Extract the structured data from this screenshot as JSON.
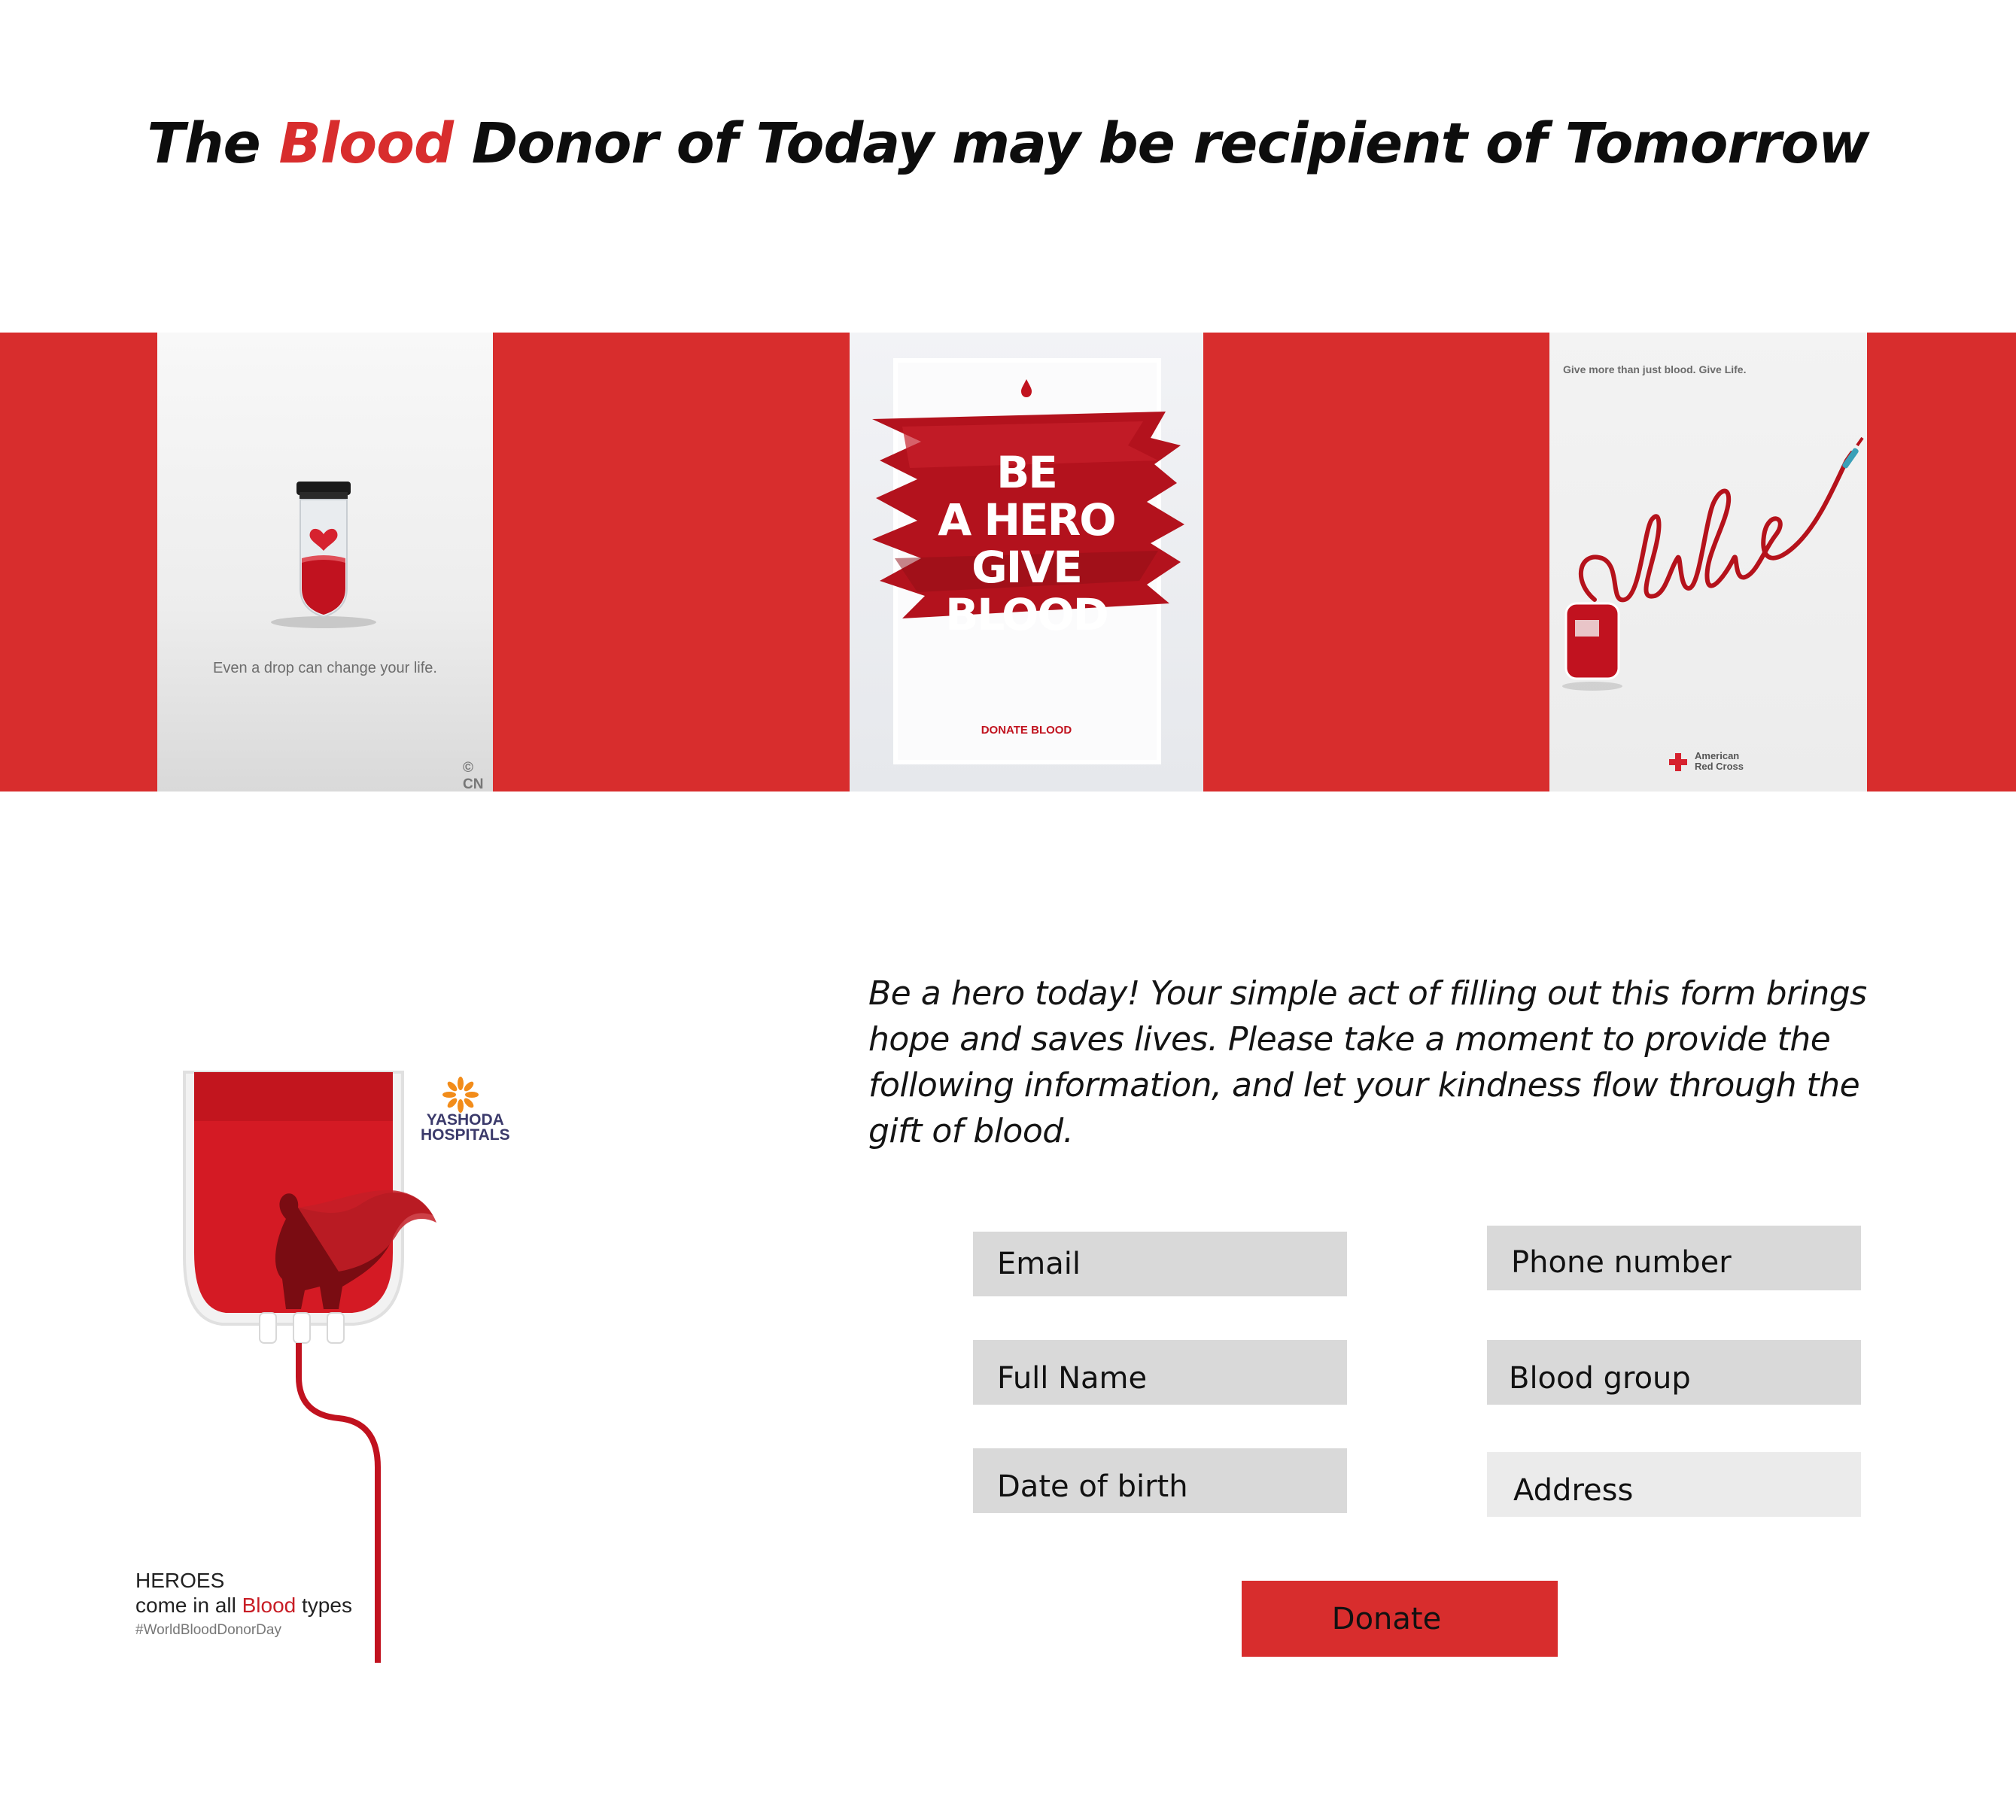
{
  "headline": {
    "before": "The ",
    "accent": "Blood",
    "after": " Donor of Today may be recipient of Tomorrow"
  },
  "colors": {
    "accent_red": "#d82d2d",
    "field_gray": "#d9d9d9",
    "field_light_gray": "#ebebeb",
    "text": "#111111"
  },
  "banner": {
    "poster1": {
      "caption": "Even a drop can change your life.",
      "credit": "© CN"
    },
    "poster2": {
      "lines": [
        "BE",
        "A HERO",
        "GIVE",
        "BLOOD"
      ],
      "footer": "DONATE BLOOD"
    },
    "poster3": {
      "tagline": "Give more than just blood. Give Life.",
      "script_word": "life",
      "org_line1": "American",
      "org_line2": "Red Cross"
    }
  },
  "hero_poster": {
    "brand_line1": "YASHODA",
    "brand_line2": "HOSPITALS",
    "caption_line1": "HEROES",
    "caption_line2_before": "come in all ",
    "caption_line2_accent": "Blood",
    "caption_line2_after": " types",
    "hashtag": "#WorldBloodDonorDay"
  },
  "intro": {
    "lines": [
      "Be a hero today! Your simple act of filling out this form brings",
      "hope and saves lives. Please take a moment to provide the",
      "following information, and let your kindness flow through the",
      "gift of blood."
    ]
  },
  "form": {
    "email": "Email",
    "phone": "Phone number",
    "full_name": "Full Name",
    "blood_group": "Blood group",
    "dob": "Date of birth",
    "address": "Address",
    "submit": "Donate"
  }
}
